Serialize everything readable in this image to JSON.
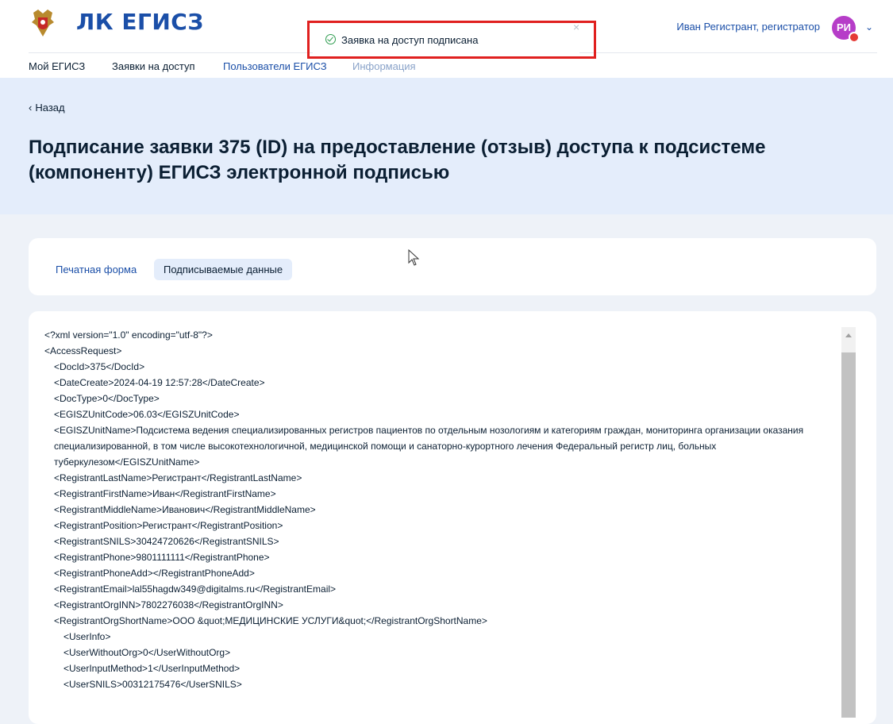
{
  "header": {
    "brand": "ЛК ЕГИСЗ",
    "user_name": "Иван Регистрант, регистратор",
    "avatar_initials": "РИ"
  },
  "nav": [
    {
      "label": "Мой ЕГИСЗ"
    },
    {
      "label": "Заявки на доступ"
    },
    {
      "label": "Пользователи ЕГИСЗ"
    },
    {
      "label": "Информация"
    }
  ],
  "toast": {
    "message": "Заявка на доступ подписана",
    "close": "×"
  },
  "page": {
    "back_label": "Назад",
    "title": "Подписание заявки 375 (ID) на предоставление (отзыв) доступа к подсистеме (компоненту) ЕГИСЗ электронной подписью"
  },
  "tabs": [
    {
      "label": "Печатная форма",
      "active": false
    },
    {
      "label": "Подписываемые данные",
      "active": true
    }
  ],
  "xml_lines": [
    "<?xml version=\"1.0\" encoding=\"utf-8\"?>",
    "<AccessRequest>",
    "  <DocId>375</DocId>",
    "  <DateCreate>2024-04-19 12:57:28</DateCreate>",
    "  <DocType>0</DocType>",
    "  <EGISZUnitCode>06.03</EGISZUnitCode>",
    "  <EGISZUnitName>Подсистема ведения специализированных регистров пациентов по отдельным нозологиям и категориям граждан, мониторинга организации оказания специализированной, в том числе высокотехнологичной, медицинской помощи и санаторно-курортного лечения Федеральный регистр лиц, больных туберкулезом</EGISZUnitName>",
    "  <RegistrantLastName>Регистрант</RegistrantLastName>",
    "  <RegistrantFirstName>Иван</RegistrantFirstName>",
    "  <RegistrantMiddleName>Иванович</RegistrantMiddleName>",
    "  <RegistrantPosition>Регистрант</RegistrantPosition>",
    "  <RegistrantSNILS>30424720626</RegistrantSNILS>",
    "  <RegistrantPhone>9801111111</RegistrantPhone>",
    "  <RegistrantPhoneAdd></RegistrantPhoneAdd>",
    "  <RegistrantEmail>lal55hagdw349@digitalms.ru</RegistrantEmail>",
    "  <RegistrantOrgINN>7802276038</RegistrantOrgINN>",
    "  <RegistrantOrgShortName>ООО &quot;МЕДИЦИНСКИЕ УСЛУГИ&quot;</RegistrantOrgShortName>",
    "    <UserInfo>",
    "    <UserWithoutOrg>0</UserWithoutOrg>",
    "    <UserInputMethod>1</UserInputMethod>",
    "    <UserSNILS>00312175476</UserSNILS>"
  ],
  "colors": {
    "brand_blue": "#1b4fa8",
    "title_bg": "#e4edfb",
    "page_bg": "#eef2f8",
    "avatar": "#b63dc8",
    "success": "#2e9c4f",
    "highlight": "#e0201f"
  },
  "icons": {
    "emblem": "coat-of-arms-icon",
    "toast": "check-circle-icon",
    "back": "chevron-left-icon",
    "menu": "chevron-down-icon"
  }
}
